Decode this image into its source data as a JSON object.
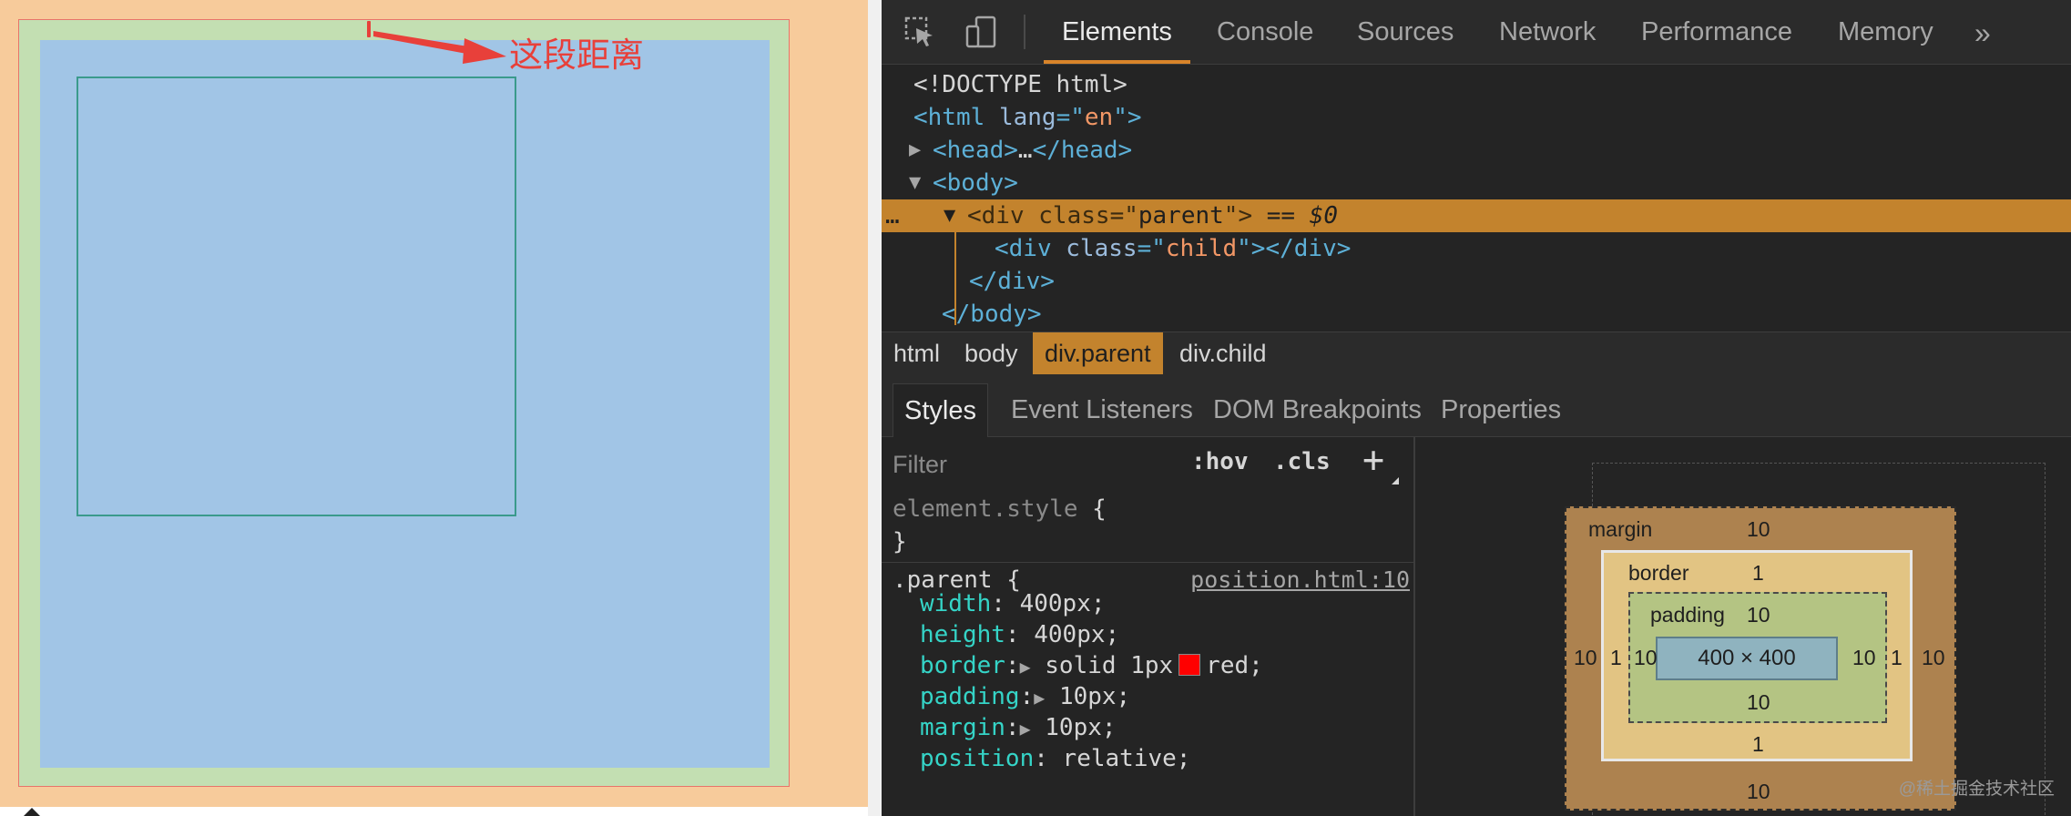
{
  "page": {
    "annotation_text": "这段距离"
  },
  "devtools": {
    "tabs": {
      "elements": "Elements",
      "console": "Console",
      "sources": "Sources",
      "network": "Network",
      "performance": "Performance",
      "memory": "Memory",
      "more": "»"
    },
    "dom": {
      "doctype": "<!DOCTYPE html>",
      "html_tag": "html",
      "lang_attr": "lang",
      "lang_value": "en",
      "head_open": "<head>",
      "head_ellipsis": "…",
      "head_close": "</head>",
      "body_open": "<body>",
      "div_tag": "div",
      "class_attr": "class",
      "parent_class": "parent",
      "selected_suffix": "== $0",
      "child_class": "child",
      "div_close": "</div>",
      "body_close": "</body>"
    },
    "breadcrumbs": [
      "html",
      "body",
      "div.parent",
      "div.child"
    ],
    "sub_tabs": {
      "styles": "Styles",
      "event_listeners": "Event Listeners",
      "dom_breakpoints": "DOM Breakpoints",
      "properties": "Properties"
    },
    "filter": {
      "placeholder": "Filter",
      "hov": ":hov",
      "cls": ".cls",
      "plus": "+"
    },
    "element_style": {
      "selector": "element.style",
      "open": "{",
      "close": "}"
    },
    "parent_rule": {
      "selector": ".parent",
      "open": "{",
      "source": "position.html:10",
      "props": {
        "width": {
          "name": "width",
          "value": "400px;"
        },
        "height": {
          "name": "height",
          "value": "400px;"
        },
        "border": {
          "name": "border",
          "value_a": "solid 1px",
          "value_b": "red;",
          "swatch_color": "#ff0000"
        },
        "padding": {
          "name": "padding",
          "value": "10px;"
        },
        "margin": {
          "name": "margin",
          "value": "10px;"
        },
        "position": {
          "name": "position",
          "value": "relative;"
        }
      }
    },
    "box_model": {
      "margin_label": "margin",
      "border_label": "border",
      "padding_label": "padding",
      "margin": {
        "top": "10",
        "right": "10",
        "bottom": "10",
        "left": "10"
      },
      "border": {
        "top": "1",
        "right": "1",
        "bottom": "1",
        "left": "1"
      },
      "padding": {
        "top": "10",
        "right": "10",
        "bottom": "10",
        "left": "10"
      },
      "content": "400 × 400"
    },
    "watermark": "@稀土掘金技术社区"
  }
}
